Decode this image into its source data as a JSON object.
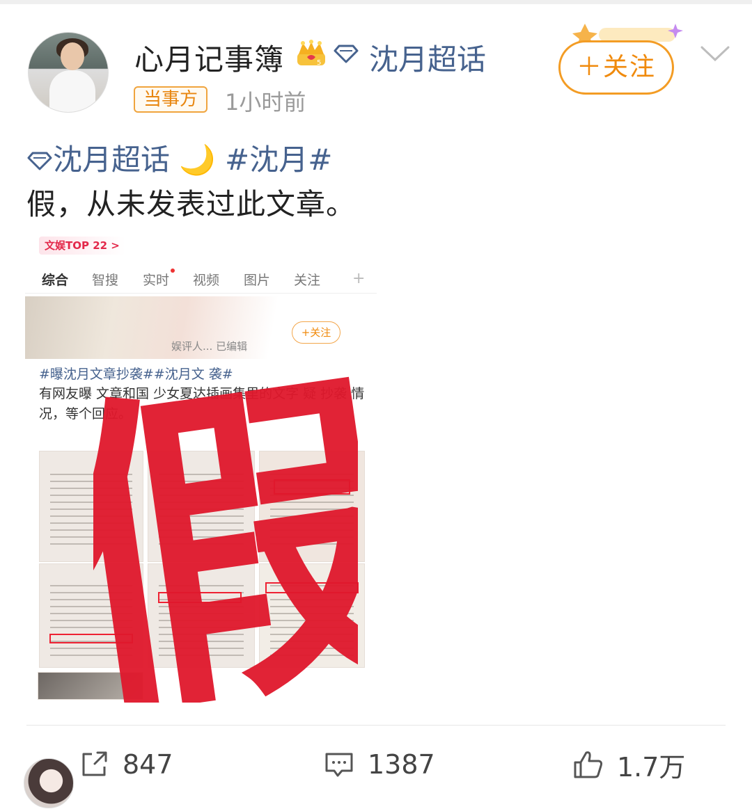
{
  "user": {
    "name": "心月记事簿",
    "supertopic_link": "沈月超话",
    "badge": "当事方",
    "time": "1小时前"
  },
  "follow_label": "＋关注",
  "post": {
    "supertopic": "沈月超话",
    "hashtag": "#沈月#",
    "body": "假，从未发表过此文章。"
  },
  "embedded_image": {
    "rank": "文娱TOP 22 >",
    "tabs": [
      "综合",
      "智搜",
      "实时",
      "视频",
      "图片",
      "关注",
      "+"
    ],
    "follow_label": "+关注",
    "meta": "娱评人... 已编辑",
    "tagline": "#曝沈月文章抄袭##沈月文    袭#",
    "text": "有网友曝    文章和国    少女夏达插画集里的文字    疑    抄袭    情况，等个回应。",
    "stamp_text": "假"
  },
  "actions": {
    "repost_count": "847",
    "comment_count": "1387",
    "like_count": "1.7万"
  },
  "colors": {
    "link": "#46628e",
    "accent": "#f08a0c",
    "stamp_red": "#e0182c"
  }
}
